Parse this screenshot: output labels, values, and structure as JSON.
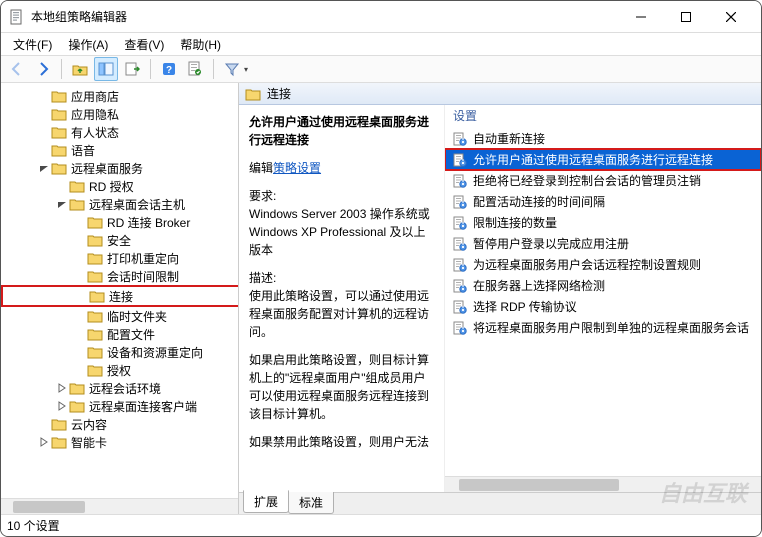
{
  "icons": {
    "back": "back-arrow",
    "forward": "forward-arrow",
    "up": "up-folder",
    "showhide": "toggle-pane",
    "export": "export-list",
    "help": "help-circle",
    "properties": "properties-sheet",
    "filter": "filter-funnel"
  },
  "window": {
    "title": "本地组策略编辑器"
  },
  "menu": {
    "file": "文件(F)",
    "action": "操作(A)",
    "view": "查看(V)",
    "help": "帮助(H)"
  },
  "tree": {
    "items": [
      {
        "depth": 2,
        "label": "应用商店",
        "chev": ""
      },
      {
        "depth": 2,
        "label": "应用隐私",
        "chev": ""
      },
      {
        "depth": 2,
        "label": "有人状态",
        "chev": ""
      },
      {
        "depth": 2,
        "label": "语音",
        "chev": ""
      },
      {
        "depth": 2,
        "label": "远程桌面服务",
        "chev": "expanded"
      },
      {
        "depth": 3,
        "label": "RD 授权",
        "chev": ""
      },
      {
        "depth": 3,
        "label": "远程桌面会话主机",
        "chev": "expanded"
      },
      {
        "depth": 4,
        "label": "RD 连接 Broker",
        "chev": ""
      },
      {
        "depth": 4,
        "label": "安全",
        "chev": ""
      },
      {
        "depth": 4,
        "label": "打印机重定向",
        "chev": ""
      },
      {
        "depth": 4,
        "label": "会话时间限制",
        "chev": ""
      },
      {
        "depth": 4,
        "label": "连接",
        "chev": "",
        "highlight": true
      },
      {
        "depth": 4,
        "label": "临时文件夹",
        "chev": ""
      },
      {
        "depth": 4,
        "label": "配置文件",
        "chev": ""
      },
      {
        "depth": 4,
        "label": "设备和资源重定向",
        "chev": ""
      },
      {
        "depth": 4,
        "label": "授权",
        "chev": ""
      },
      {
        "depth": 3,
        "label": "远程会话环境",
        "chev": "collapsed"
      },
      {
        "depth": 3,
        "label": "远程桌面连接客户端",
        "chev": "collapsed"
      },
      {
        "depth": 2,
        "label": "云内容",
        "chev": ""
      },
      {
        "depth": 2,
        "label": "智能卡",
        "chev": "collapsed"
      }
    ]
  },
  "details": {
    "header": "连接",
    "selected_title": "允许用户通过使用远程桌面服务进行远程连接",
    "edit_label_prefix": "编辑",
    "edit_link": "策略设置",
    "requirements_head": "要求:",
    "requirements_body": "Windows Server 2003 操作系统或 Windows XP Professional 及以上版本",
    "description_head": "描述:",
    "description_body1": "使用此策略设置，可以通过使用远程桌面服务配置对计算机的远程访问。",
    "description_body2": "如果启用此策略设置，则目标计算机上的\"远程桌面用户\"组成员用户可以使用远程桌面服务远程连接到该目标计算机。",
    "description_body3": "如果禁用此策略设置，则用户无法"
  },
  "settings": {
    "column_header": "设置",
    "items": [
      {
        "label": "自动重新连接"
      },
      {
        "label": "允许用户通过使用远程桌面服务进行远程连接",
        "selected": true,
        "highlight": true
      },
      {
        "label": "拒绝将已经登录到控制台会话的管理员注销"
      },
      {
        "label": "配置活动连接的时间间隔"
      },
      {
        "label": "限制连接的数量"
      },
      {
        "label": "暂停用户登录以完成应用注册"
      },
      {
        "label": "为远程桌面服务用户会话远程控制设置规则"
      },
      {
        "label": "在服务器上选择网络检测"
      },
      {
        "label": "选择 RDP 传输协议"
      },
      {
        "label": "将远程桌面服务用户限制到单独的远程桌面服务会话"
      }
    ]
  },
  "tabs": {
    "extended": "扩展",
    "standard": "标准"
  },
  "status": {
    "text": "10 个设置"
  },
  "watermark": "自由互联"
}
